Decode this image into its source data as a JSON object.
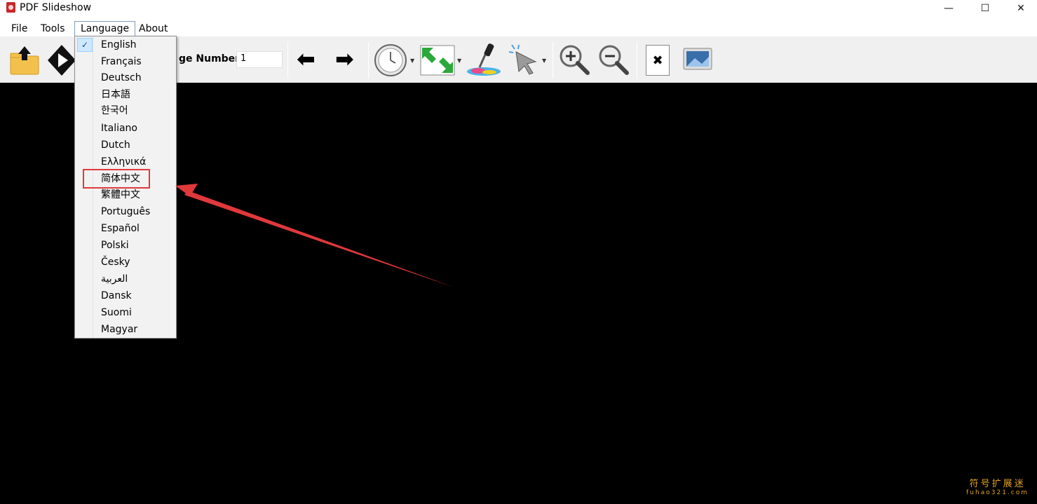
{
  "window": {
    "title": "PDF Slideshow",
    "minimize_glyph": "—",
    "maximize_glyph": "☐",
    "close_glyph": "✕"
  },
  "menu": {
    "file": "File",
    "tools": "Tools",
    "language": "Language",
    "about": "About"
  },
  "toolbar": {
    "page_number_label": "ge Number",
    "page_number_value": "1",
    "prev_glyph": "⬅",
    "next_glyph": "➡",
    "close_doc_glyph": "✖"
  },
  "language_menu": {
    "selected": "English",
    "highlighted": "简体中文",
    "check_glyph": "✓",
    "items": [
      "English",
      "Français",
      "Deutsch",
      "日本語",
      "한국어",
      "Italiano",
      "Dutch",
      "Ελληνικά",
      "简体中文",
      "繁體中文",
      "Português",
      "Español",
      "Polski",
      "Česky",
      "العربية",
      "Dansk",
      "Suomi",
      "Magyar"
    ]
  },
  "watermark": {
    "cn": "符号扩展迷",
    "en": "fuhao321.com"
  },
  "colors": {
    "annotation_red": "#e0393b",
    "watermark": "#e0a020",
    "content_bg": "#000000"
  }
}
